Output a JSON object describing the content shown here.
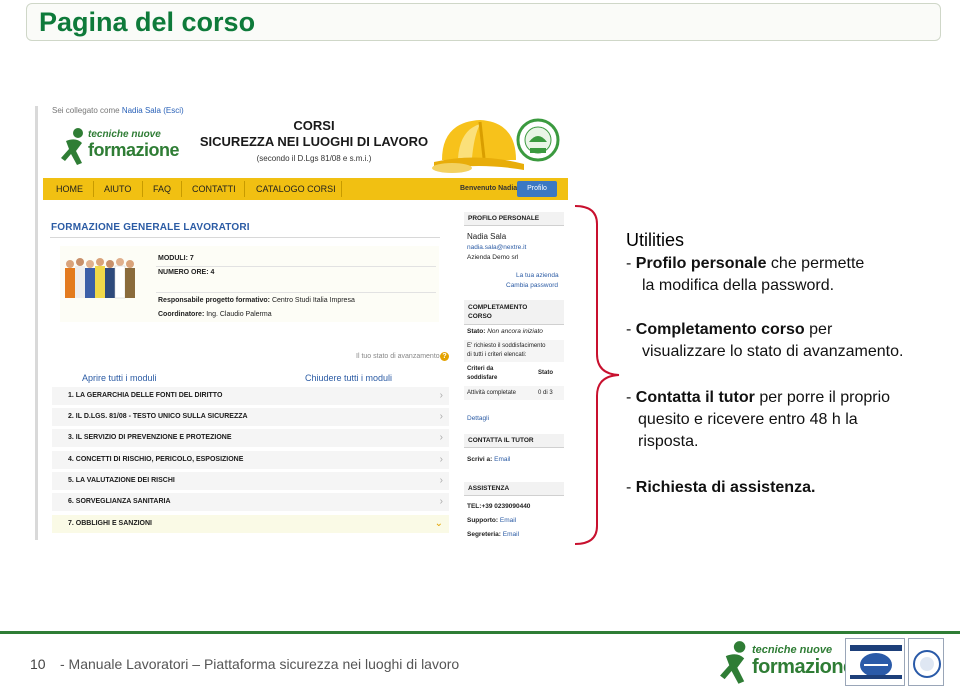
{
  "slide": {
    "title": "Pagina del corso",
    "footer_number": "10",
    "footer_text": "-   Manuale Lavoratori – Piattaforma sicurezza nei luoghi di lavoro"
  },
  "screenshot": {
    "logged_as_prefix": "Sei collegato come",
    "logged_user": "Nadia Sala",
    "logout": "(Esci)",
    "logo_line1": "tecniche nuove",
    "logo_line2": "formazione",
    "header_title1": "CORSI",
    "header_title2": "SICUREZZA NEI LUOGHI DI LAVORO",
    "header_subtitle": "(secondo il D.Lgs 81/08 e s.m.i.)",
    "nav": [
      "HOME",
      "AIUTO",
      "FAQ",
      "CONTATTI",
      "CATALOGO CORSI"
    ],
    "welcome": "Benvenuto Nadia",
    "profile_button": "Profilo",
    "course_title": "FORMAZIONE GENERALE LAVORATORI",
    "moduli": "MODULI: 7",
    "ore": "NUMERO ORE: 4",
    "responsabile_label": "Responsabile progetto formativo:",
    "responsabile_value": "Centro Studi Italia Impresa",
    "coordinatore_label": "Coordinatore:",
    "coordinatore_value": "Ing. Claudio Palerma",
    "progress_hint": "Il tuo stato di avanzamento",
    "open_all": "Aprire tutti i moduli",
    "close_all": "Chiudere tutti i moduli",
    "modules": [
      "1. LA GERARCHIA DELLE FONTI DEL DIRITTO",
      "2. IL D.LGS. 81/08 - TESTO UNICO SULLA SICUREZZA",
      "3. IL SERVIZIO DI PREVENZIONE E PROTEZIONE",
      "4. CONCETTI DI RISCHIO, PERICOLO, ESPOSIZIONE",
      "5. LA VALUTAZIONE DEI RISCHI",
      "6. SORVEGLIANZA SANITARIA",
      "7. OBBLIGHI E SANZIONI"
    ],
    "profile": {
      "heading": "PROFILO PERSONALE",
      "name": "Nadia Sala",
      "email": "nadia.sala@nextre.it",
      "company": "Azienda Demo srl",
      "your_company": "La tua azienda",
      "change_password": "Cambia password"
    },
    "completion": {
      "heading_1": "COMPLETAMENTO",
      "heading_2": "CORSO",
      "stato_label": "Stato:",
      "stato_value": "Non ancora iniziato",
      "requirement_1": "E' richiesto il soddisfacimento",
      "requirement_2": "di tutti i criteri elencati:",
      "criteria_1": "Criteri da",
      "criteria_2": "soddisfare",
      "stato_col": "Stato",
      "activity": "Attività completate",
      "activity_value": "0 di 3",
      "details": "Dettagli"
    },
    "tutor": {
      "heading": "CONTATTA IL TUTOR",
      "write_label": "Scrivi a:",
      "write_link": "Email"
    },
    "assistance": {
      "heading": "ASSISTENZA",
      "tel": "TEL:+39 0239090440",
      "support_label": "Supporto:",
      "support_link": "Email",
      "secretary_label": "Segreteria:",
      "secretary_link": "Email"
    }
  },
  "notes": {
    "heading": "Utilities",
    "item1_bold": "Profilo personale",
    "item1_rest": " che permette",
    "item1_line2": "la modifica della password.",
    "item2_bold": "Completamento corso",
    "item2_rest": " per",
    "item2_line2": "visualizzare lo stato di avanzamento.",
    "item3_bold": "Contatta il tutor",
    "item3_rest": " per porre il proprio",
    "item3_line2": "quesito e ricevere entro 48 h la",
    "item3_line3": "risposta.",
    "item4_bold": "Richiesta di assistenza."
  },
  "footer_logo": {
    "line1": "tecniche nuove",
    "line2": "formazione"
  },
  "colors": {
    "title_green": "#0e7a3a",
    "nav_yellow": "#f1c012",
    "link_blue": "#2b5ba4",
    "brace_red": "#c8102e"
  }
}
